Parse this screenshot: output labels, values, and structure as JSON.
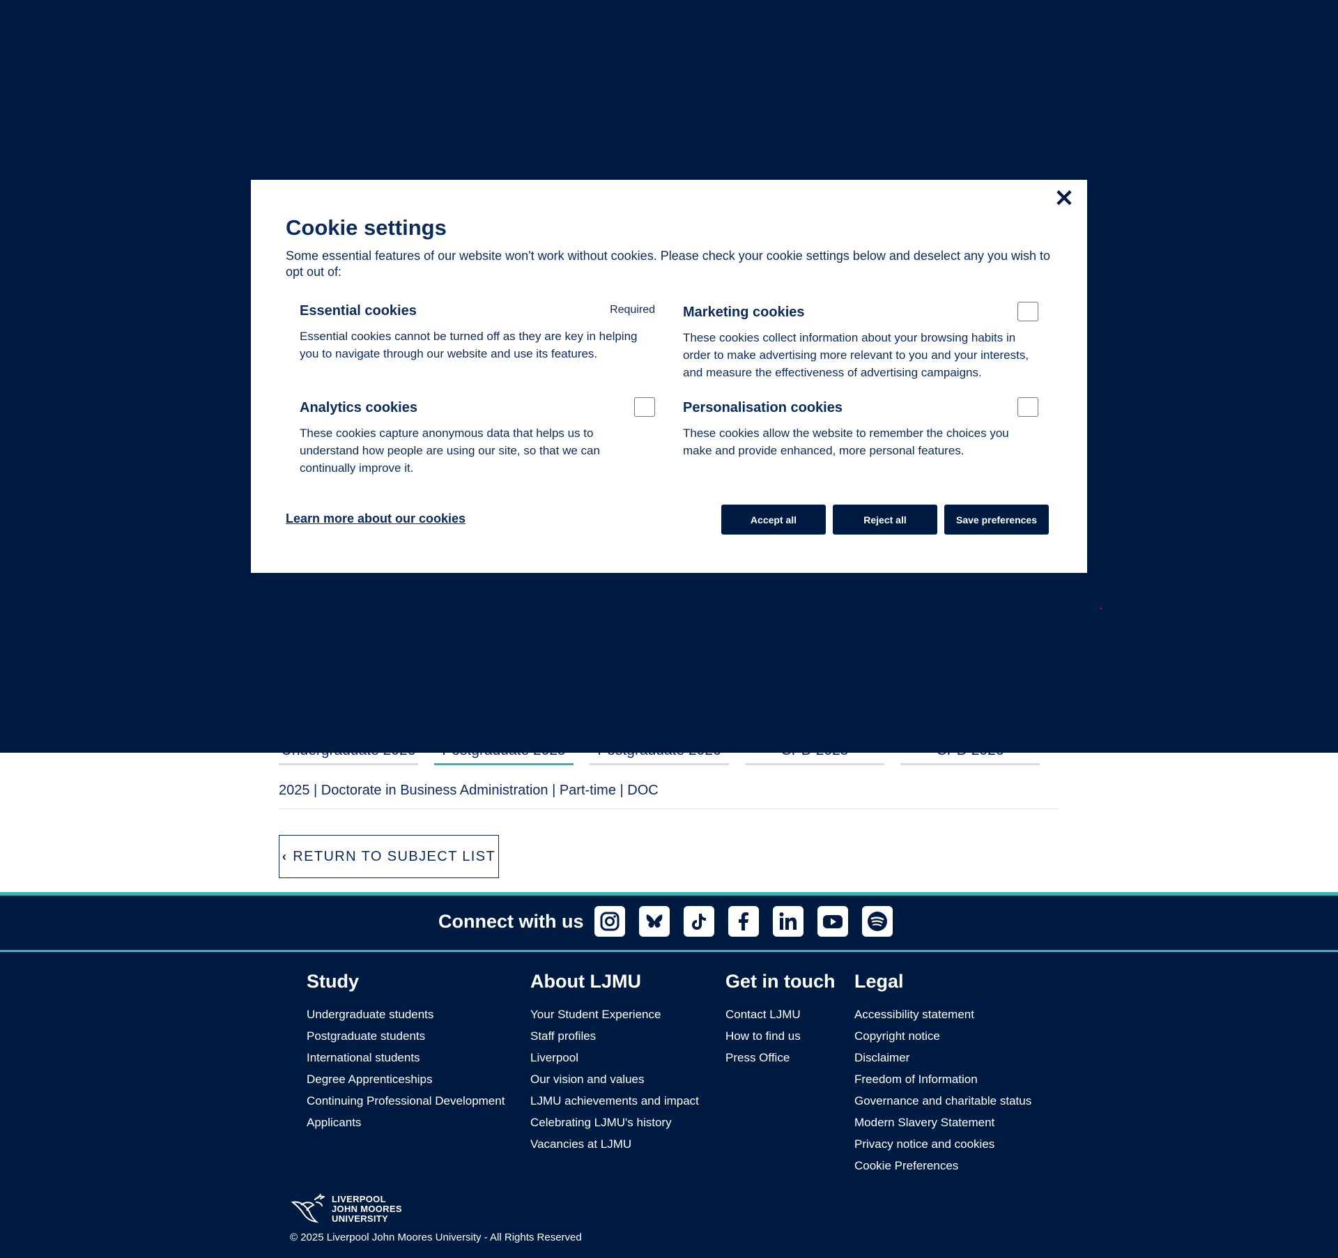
{
  "tabs": [
    "Undergraduate 2026",
    "Postgraduate 2025",
    "Postgraduate 2026",
    "CPD 2025",
    "CPD 2026"
  ],
  "active_tab_index": 1,
  "course_line": "2025 | Doctorate in Business Administration | Part-time | DOC",
  "return_button": "RETURN TO SUBJECT LIST",
  "modal": {
    "title": "Cookie settings",
    "intro": "Some essential features of our website won't work without cookies. Please check your cookie settings below and deselect any you wish to opt out of:",
    "essential": {
      "title": "Essential cookies",
      "required": "Required",
      "desc": "Essential cookies cannot be turned off as they are key in helping you to navigate through our website and use its features."
    },
    "marketing": {
      "title": "Marketing cookies",
      "desc": "These cookies collect information about your browsing habits in order to make advertising more relevant to you and your interests, and measure the effectiveness of advertising campaigns."
    },
    "analytics": {
      "title": "Analytics cookies",
      "desc": "These cookies capture anonymous data that helps us to understand how people are using our site, so that we can continually improve it."
    },
    "personalisation": {
      "title": "Personalisation cookies",
      "desc": "These cookies allow the website to remember the choices you make and provide enhanced, more personal features."
    },
    "learn_more": "Learn more about our cookies",
    "accept_all": "Accept all",
    "reject_all": "Reject all",
    "save_preferences": "Save preferences"
  },
  "connect": {
    "label": "Connect with us",
    "icons": [
      "instagram-icon",
      "bluesky-icon",
      "tiktok-icon",
      "facebook-icon",
      "linkedin-icon",
      "youtube-icon",
      "spotify-icon"
    ]
  },
  "footer": {
    "study": {
      "title": "Study",
      "links": [
        "Undergraduate students",
        "Postgraduate students",
        "International students",
        "Degree Apprenticeships",
        "Continuing Professional Development",
        "Applicants"
      ]
    },
    "about": {
      "title": "About LJMU",
      "links": [
        "Your Student Experience",
        "Staff profiles",
        "Liverpool",
        "Our vision and values",
        "LJMU achievements and impact",
        "Celebrating LJMU's history",
        "Vacancies at LJMU"
      ]
    },
    "contact": {
      "title": "Get in touch",
      "links": [
        "Contact LJMU",
        "How to find us",
        "Press Office"
      ]
    },
    "legal": {
      "title": "Legal",
      "links": [
        "Accessibility statement",
        "Copyright notice",
        "Disclaimer",
        "Freedom of Information",
        "Governance and charitable status",
        "Modern Slavery Statement",
        "Privacy notice and cookies",
        "Cookie Preferences"
      ]
    },
    "brand_lines": [
      "LIVERPOOL",
      "JOHN MOORES",
      "UNIVERSITY"
    ],
    "copyright": "© 2025 Liverpool John Moores University - All Rights Reserved"
  },
  "colors": {
    "navy": "#001b42",
    "text_navy": "#0b2a5c",
    "teal": "#32b8b0"
  }
}
